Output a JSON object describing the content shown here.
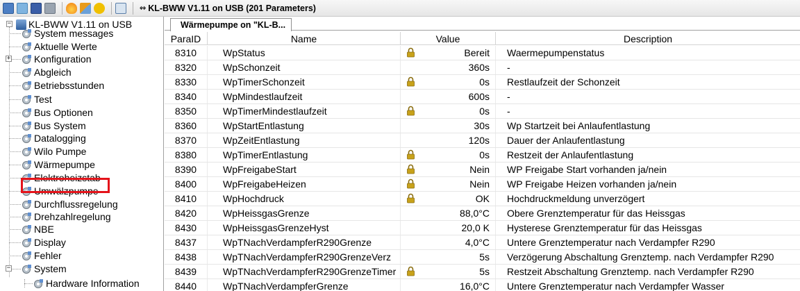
{
  "toolbar": {
    "title": "KL-BWW V1.11 on USB (201 Parameters)",
    "usb_glyph": "↭",
    "icons": [
      "connect-icon",
      "refresh-icon",
      "save-icon",
      "print-icon",
      "flame-icon",
      "tools-icon",
      "undo-icon",
      "export-icon"
    ]
  },
  "tree": {
    "root_label": "KL-BWW V1.11 on USB",
    "items": [
      {
        "label": "System messages"
      },
      {
        "label": "Aktuelle Werte"
      },
      {
        "label": "Konfiguration"
      },
      {
        "label": "Abgleich"
      },
      {
        "label": "Betriebsstunden"
      },
      {
        "label": "Test"
      },
      {
        "label": "Bus Optionen"
      },
      {
        "label": "Bus System"
      },
      {
        "label": "Datalogging"
      },
      {
        "label": "Wilo Pumpe"
      },
      {
        "label": "Wärmepumpe"
      },
      {
        "label": "Elektroheizstab"
      },
      {
        "label": "Umwälzpumpe"
      },
      {
        "label": "Durchflussregelung"
      },
      {
        "label": "Drehzahlregelung"
      },
      {
        "label": "NBE"
      },
      {
        "label": "Display"
      },
      {
        "label": "Fehler"
      },
      {
        "label": "System"
      },
      {
        "label": "Hardware Information"
      }
    ],
    "selected": "Wärmepumpe"
  },
  "tab": {
    "label": "Wärmepumpe on \"KL-B..."
  },
  "table": {
    "headers": {
      "paraid": "ParaID",
      "name": "Name",
      "value": "Value",
      "description": "Description"
    },
    "rows": [
      {
        "id": "8310",
        "name": "WpStatus",
        "locked": true,
        "value": "Bereit",
        "desc": "Waermepumpenstatus"
      },
      {
        "id": "8320",
        "name": "WpSchonzeit",
        "locked": false,
        "value": "360s",
        "desc": "-"
      },
      {
        "id": "8330",
        "name": "WpTimerSchonzeit",
        "locked": true,
        "value": "0s",
        "desc": "Restlaufzeit der Schonzeit"
      },
      {
        "id": "8340",
        "name": "WpMindestlaufzeit",
        "locked": false,
        "value": "600s",
        "desc": "-"
      },
      {
        "id": "8350",
        "name": "WpTimerMindestlaufzeit",
        "locked": true,
        "value": "0s",
        "desc": "-"
      },
      {
        "id": "8360",
        "name": "WpStartEntlastung",
        "locked": false,
        "value": "30s",
        "desc": "Wp Startzeit bei Anlaufentlastung"
      },
      {
        "id": "8370",
        "name": "WpZeitEntlastung",
        "locked": false,
        "value": "120s",
        "desc": "Dauer der Anlaufentlastung"
      },
      {
        "id": "8380",
        "name": "WpTimerEntlastung",
        "locked": true,
        "value": "0s",
        "desc": "Restzeit der Anlaufentlastung"
      },
      {
        "id": "8390",
        "name": "WpFreigabeStart",
        "locked": true,
        "value": "Nein",
        "desc": "WP Freigabe Start vorhanden ja/nein"
      },
      {
        "id": "8400",
        "name": "WpFreigabeHeizen",
        "locked": true,
        "value": "Nein",
        "desc": "WP Freigabe Heizen vorhanden ja/nein"
      },
      {
        "id": "8410",
        "name": "WpHochdruck",
        "locked": true,
        "value": "OK",
        "desc": "Hochdruckmeldung unverzögert"
      },
      {
        "id": "8420",
        "name": "WpHeissgasGrenze",
        "locked": false,
        "value": "88,0°C",
        "desc": "Obere Grenztemperatur für das Heissgas"
      },
      {
        "id": "8430",
        "name": "WpHeissgasGrenzeHyst",
        "locked": false,
        "value": "20,0 K",
        "desc": "Hysterese Grenztemperatur für das Heissgas"
      },
      {
        "id": "8437",
        "name": "WpTNachVerdampferR290Grenze",
        "locked": false,
        "value": "4,0°C",
        "desc": "Untere Grenztemperatur nach Verdampfer R290"
      },
      {
        "id": "8438",
        "name": "WpTNachVerdampferR290GrenzeVerz",
        "locked": false,
        "value": "5s",
        "desc": "Verzögerung Abschaltung Grenztemp. nach Verdampfer R290"
      },
      {
        "id": "8439",
        "name": "WpTNachVerdampferR290GrenzeTimer",
        "locked": true,
        "value": "5s",
        "desc": "Restzeit Abschaltung Grenztemp. nach Verdampfer R290"
      },
      {
        "id": "8440",
        "name": "WpTNachVerdampferGrenze",
        "locked": false,
        "value": "16,0°C",
        "desc": "Untere Grenztemperatur nach Verdampfer Wasser"
      }
    ]
  },
  "colors": {
    "highlight": "#e4131a",
    "lock": "#c8a21a"
  }
}
